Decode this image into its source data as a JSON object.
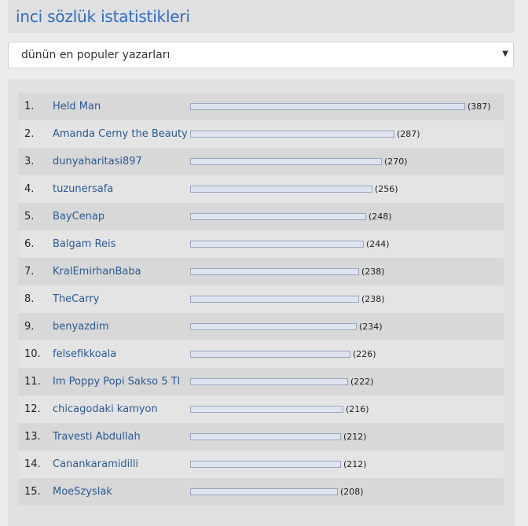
{
  "header": {
    "title": "inci sözlük istatistikleri"
  },
  "selector": {
    "selected": "dünün en populer yazarları",
    "icon": "triangle-down-icon"
  },
  "leaderboard": {
    "max": 387,
    "rows": [
      {
        "rank": "1.",
        "name": "Held Man",
        "value": 387,
        "count": "(387)"
      },
      {
        "rank": "2.",
        "name": "Amanda Cerny the Beauty",
        "value": 287,
        "count": "(287)"
      },
      {
        "rank": "3.",
        "name": "dunyaharitasi897",
        "value": 270,
        "count": "(270)"
      },
      {
        "rank": "4.",
        "name": "tuzunersafa",
        "value": 256,
        "count": "(256)"
      },
      {
        "rank": "5.",
        "name": "BayCenap",
        "value": 248,
        "count": "(248)"
      },
      {
        "rank": "6.",
        "name": "Balgam Reis",
        "value": 244,
        "count": "(244)"
      },
      {
        "rank": "7.",
        "name": "KralEmirhanBaba",
        "value": 238,
        "count": "(238)"
      },
      {
        "rank": "8.",
        "name": "TheCarry",
        "value": 238,
        "count": "(238)"
      },
      {
        "rank": "9.",
        "name": "benyazdim",
        "value": 234,
        "count": "(234)"
      },
      {
        "rank": "10.",
        "name": "felsefikkoala",
        "value": 226,
        "count": "(226)"
      },
      {
        "rank": "11.",
        "name": "Im Poppy Popi Sakso 5 Tl",
        "value": 222,
        "count": "(222)"
      },
      {
        "rank": "12.",
        "name": "chicagodaki kamyon",
        "value": 216,
        "count": "(216)"
      },
      {
        "rank": "13.",
        "name": "Travesti Abdullah",
        "value": 212,
        "count": "(212)"
      },
      {
        "rank": "14.",
        "name": "Canankaramidilli",
        "value": 212,
        "count": "(212)"
      },
      {
        "rank": "15.",
        "name": "MoeSzyslak",
        "value": 208,
        "count": "(208)"
      }
    ]
  }
}
